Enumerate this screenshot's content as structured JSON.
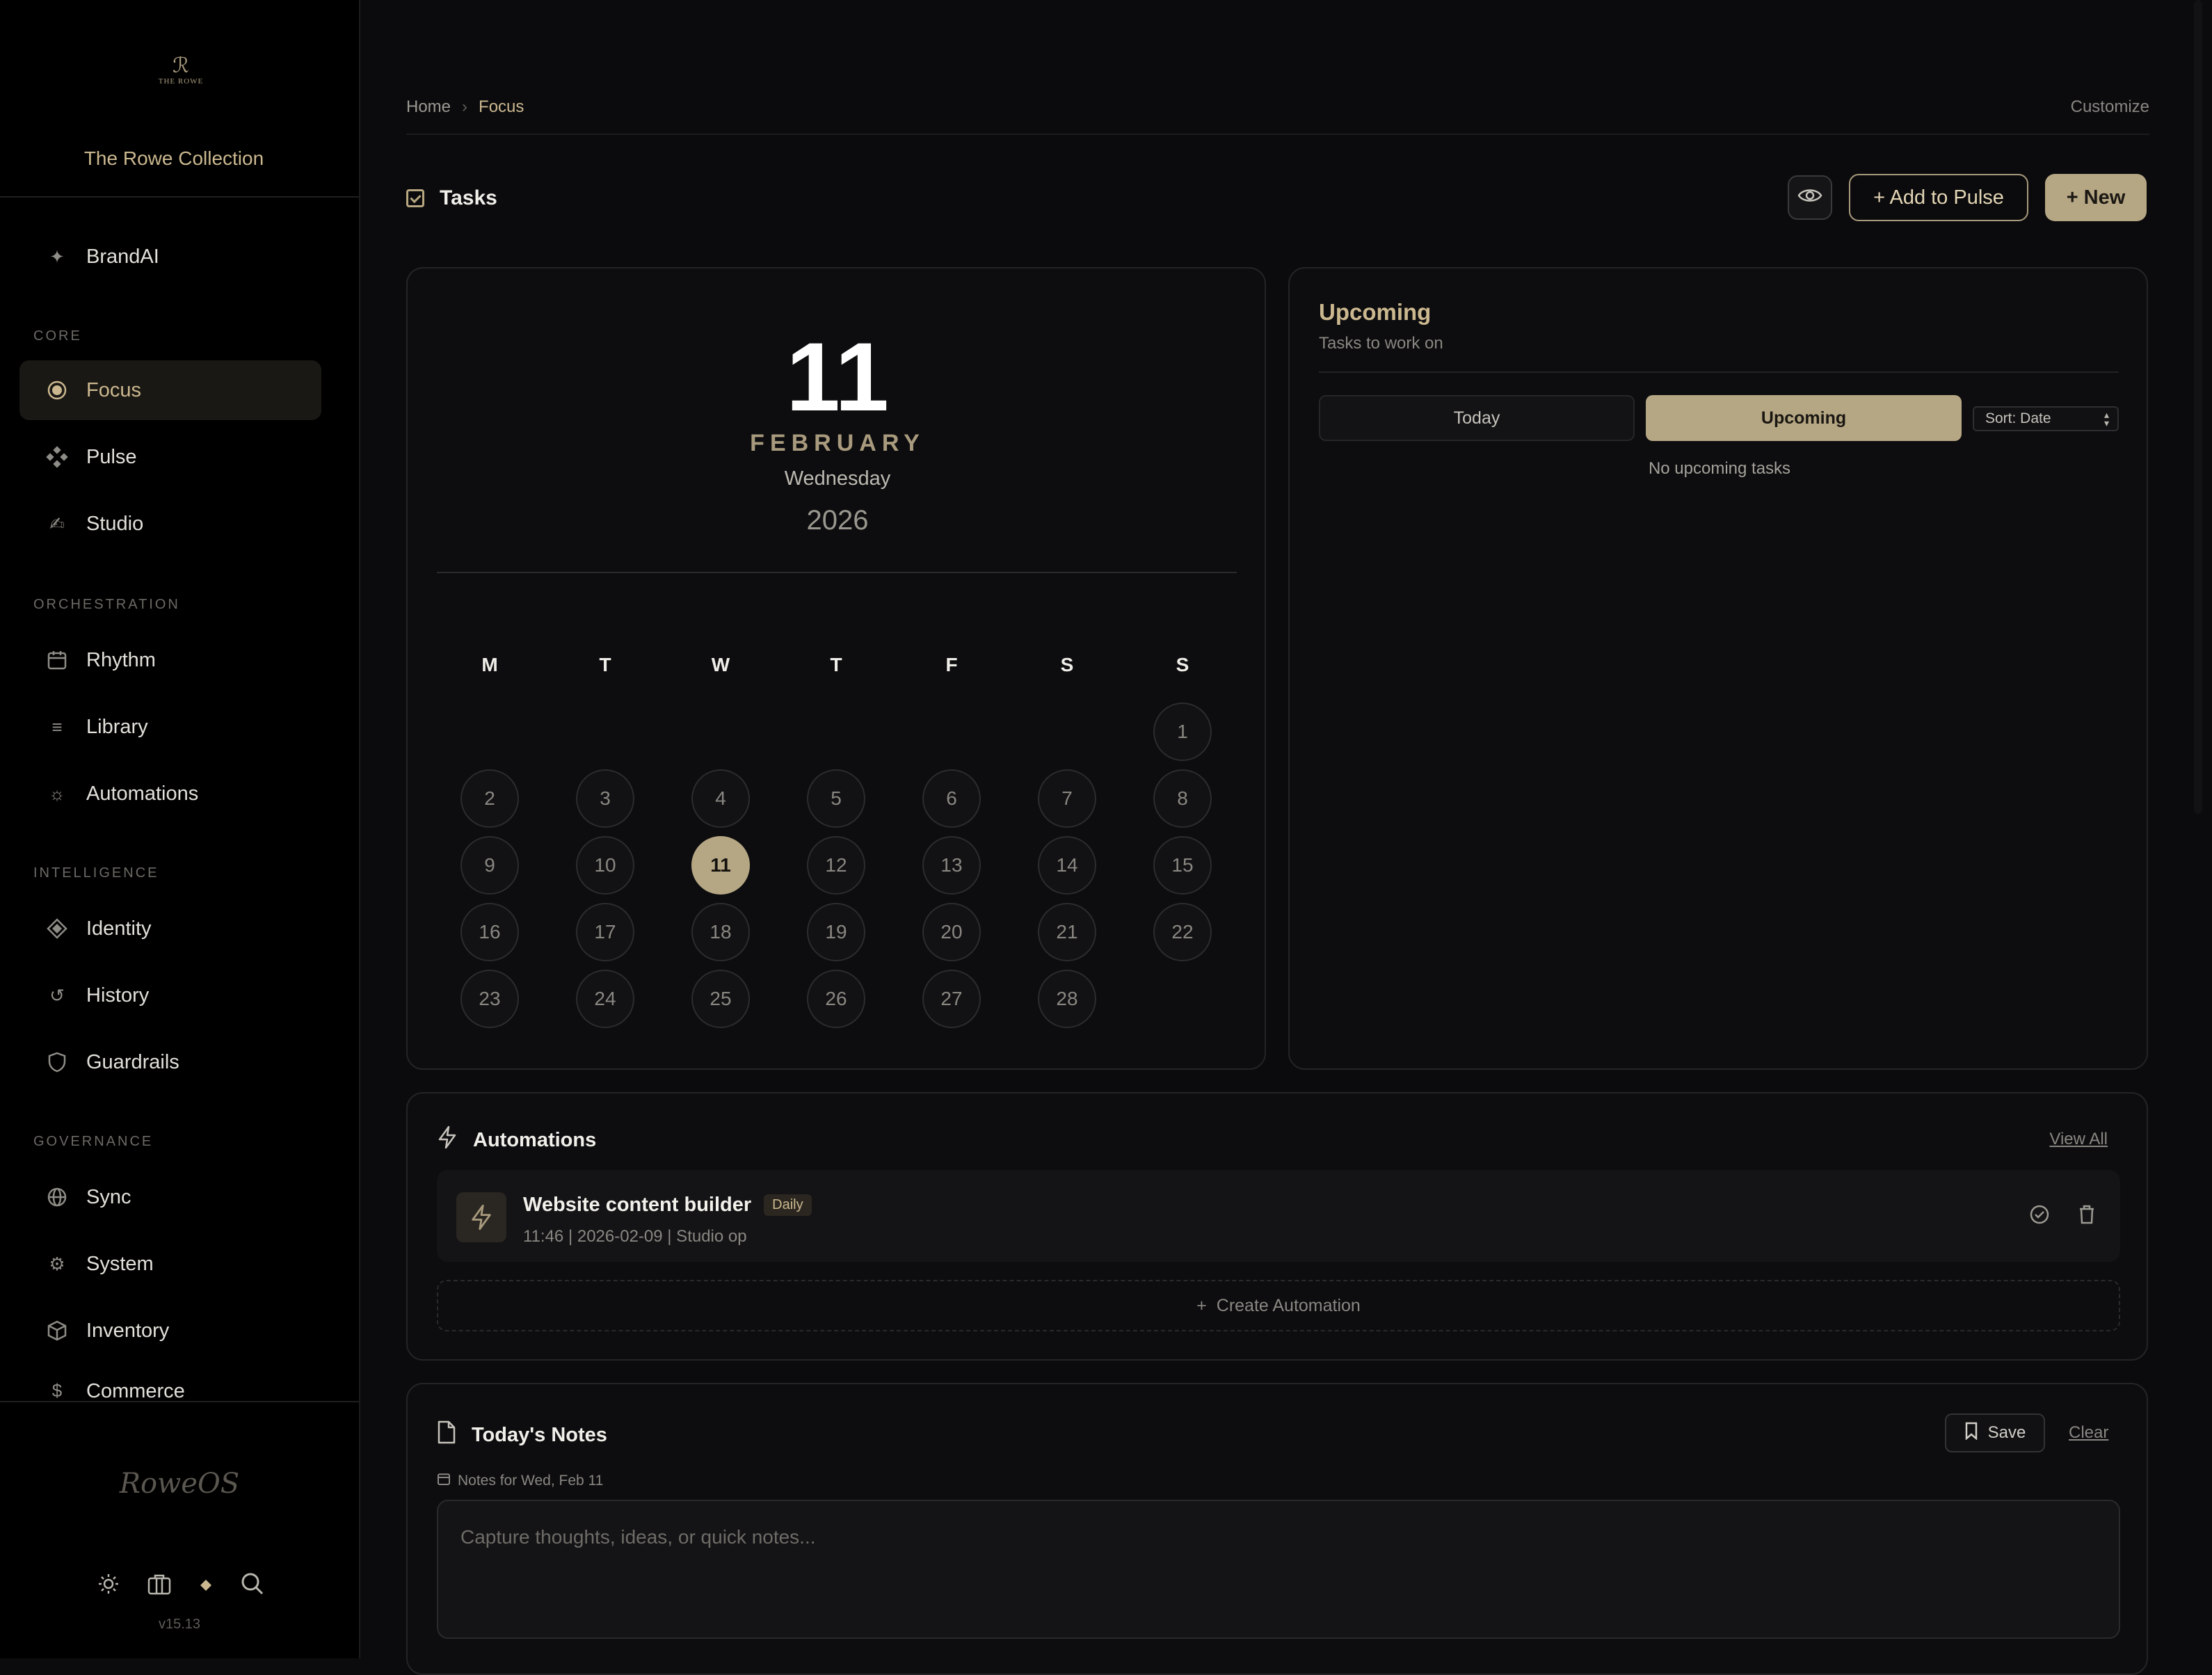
{
  "sidebar": {
    "logo_text": "THE ROWE",
    "brand_name": "The Rowe Collection",
    "brandai": "BrandAI",
    "sections": {
      "core": "CORE",
      "orchestration": "ORCHESTRATION",
      "intelligence": "INTELLIGENCE",
      "governance": "GOVERNANCE"
    },
    "items": {
      "focus": "Focus",
      "pulse": "Pulse",
      "studio": "Studio",
      "rhythm": "Rhythm",
      "library": "Library",
      "automations": "Automations",
      "identity": "Identity",
      "history": "History",
      "guardrails": "Guardrails",
      "sync": "Sync",
      "system": "System",
      "inventory": "Inventory",
      "commerce": "Commerce"
    },
    "signature": "RoweOS",
    "version": "v15.13"
  },
  "header": {
    "breadcrumb": [
      "Home",
      "Focus"
    ],
    "customize": "Customize"
  },
  "tasks": {
    "title": "Tasks",
    "add_to_pulse": "+ Add to Pulse",
    "new": "+ New"
  },
  "calendar": {
    "day": "11",
    "month": "FEBRUARY",
    "weekday": "Wednesday",
    "year": "2026",
    "dow": [
      "M",
      "T",
      "W",
      "T",
      "F",
      "S",
      "S"
    ],
    "selected": 11,
    "first_weekday_index": 6,
    "days_in_month": 28
  },
  "upcoming": {
    "title": "Upcoming",
    "subtitle": "Tasks to work on",
    "tab_today": "Today",
    "tab_upcoming": "Upcoming",
    "sort": "Sort: Date",
    "empty": "No upcoming tasks"
  },
  "automations": {
    "title": "Automations",
    "view_all": "View All",
    "item": {
      "name": "Website content builder",
      "badge": "Daily",
      "meta": "11:46 | 2026-02-09 | Studio op"
    },
    "create": "Create Automation"
  },
  "notes": {
    "title": "Today's Notes",
    "save": "Save",
    "clear": "Clear",
    "for_label": "Notes for Wed, Feb 11",
    "placeholder": "Capture thoughts, ideas, or quick notes..."
  },
  "colors": {
    "accent": "#b6a784",
    "accent_text": "#cbb88f",
    "background": "#0b0b0d",
    "sidebar": "#000000"
  }
}
